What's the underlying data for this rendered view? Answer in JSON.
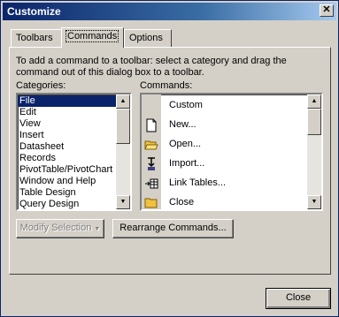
{
  "window": {
    "title": "Customize",
    "close_glyph": "✕"
  },
  "tabs": [
    {
      "label": "Toolbars",
      "active": false
    },
    {
      "label": "Commands",
      "active": true
    },
    {
      "label": "Options",
      "active": false
    }
  ],
  "instructions": "To add a command to a toolbar: select a category and drag the command out of this dialog box to a toolbar.",
  "categories": {
    "label": "Categories:",
    "items": [
      "File",
      "Edit",
      "View",
      "Insert",
      "Datasheet",
      "Records",
      "PivotTable/PivotChart",
      "Window and Help",
      "Table Design",
      "Query Design"
    ],
    "selected": "File"
  },
  "commands": {
    "label": "Commands:",
    "items": [
      {
        "label": "Custom",
        "icon": "none"
      },
      {
        "label": "New...",
        "icon": "new-document-icon"
      },
      {
        "label": "Open...",
        "icon": "open-folder-icon"
      },
      {
        "label": "Import...",
        "icon": "import-icon"
      },
      {
        "label": "Link Tables...",
        "icon": "link-tables-icon"
      },
      {
        "label": "Close",
        "icon": "close-folder-icon"
      }
    ]
  },
  "buttons": {
    "modify_selection": "Modify Selection",
    "modify_arrow": "▼",
    "rearrange": "Rearrange Commands...",
    "close": "Close"
  },
  "scroll_glyphs": {
    "up": "▲",
    "down": "▼"
  },
  "colors": {
    "title_bar": "#0a246a",
    "selection": "#0a246a",
    "dialog_face": "#d4d0c8"
  }
}
